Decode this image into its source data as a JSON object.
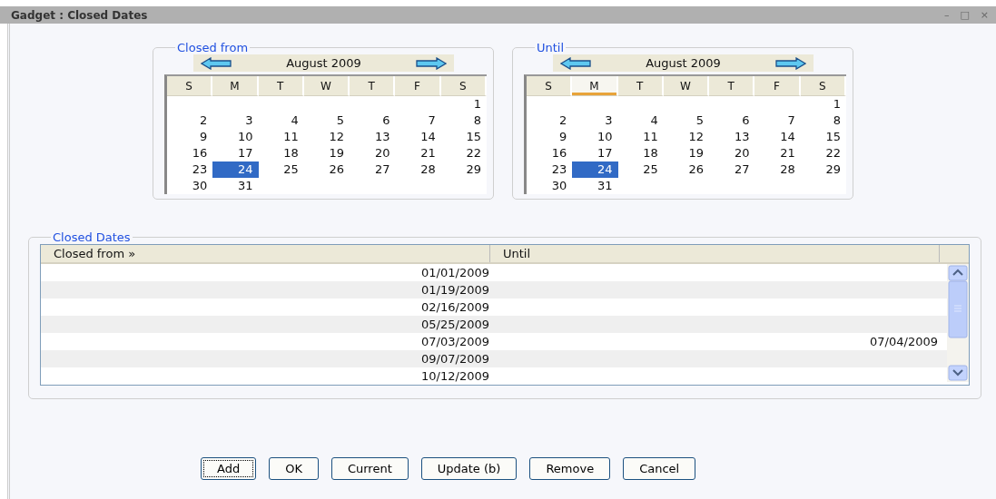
{
  "window": {
    "title": "Gadget : Closed Dates",
    "controls": [
      "–",
      "□",
      "×"
    ]
  },
  "calendars": [
    {
      "legend": "Closed from",
      "month": "August 2009",
      "weekdays": [
        {
          "label": "S",
          "highlighted": false
        },
        {
          "label": "M",
          "highlighted": false
        },
        {
          "label": "T",
          "highlighted": false
        },
        {
          "label": "W",
          "highlighted": false
        },
        {
          "label": "T",
          "highlighted": false
        },
        {
          "label": "F",
          "highlighted": false
        },
        {
          "label": "S",
          "highlighted": false
        }
      ],
      "weeks": [
        [
          {
            "day": "1",
            "selected": false
          }
        ],
        [
          {
            "day": "2",
            "selected": false
          },
          {
            "day": "3",
            "selected": false
          },
          {
            "day": "4",
            "selected": false
          },
          {
            "day": "5",
            "selected": false
          },
          {
            "day": "6",
            "selected": false
          },
          {
            "day": "7",
            "selected": false
          },
          {
            "day": "8",
            "selected": false
          }
        ],
        [
          {
            "day": "9",
            "selected": false
          },
          {
            "day": "10",
            "selected": false
          },
          {
            "day": "11",
            "selected": false
          },
          {
            "day": "12",
            "selected": false
          },
          {
            "day": "13",
            "selected": false
          },
          {
            "day": "14",
            "selected": false
          },
          {
            "day": "15",
            "selected": false
          }
        ],
        [
          {
            "day": "16",
            "selected": false
          },
          {
            "day": "17",
            "selected": false
          },
          {
            "day": "18",
            "selected": false
          },
          {
            "day": "19",
            "selected": false
          },
          {
            "day": "20",
            "selected": false
          },
          {
            "day": "21",
            "selected": false
          },
          {
            "day": "22",
            "selected": false
          }
        ],
        [
          {
            "day": "23",
            "selected": false
          },
          {
            "day": "24",
            "selected": true
          },
          {
            "day": "25",
            "selected": false
          },
          {
            "day": "26",
            "selected": false
          },
          {
            "day": "27",
            "selected": false
          },
          {
            "day": "28",
            "selected": false
          },
          {
            "day": "29",
            "selected": false
          }
        ],
        [
          {
            "day": "30",
            "selected": false
          },
          {
            "day": "31",
            "selected": false
          }
        ]
      ]
    },
    {
      "legend": "Until",
      "month": "August 2009",
      "weekdays": [
        {
          "label": "S",
          "highlighted": false
        },
        {
          "label": "M",
          "highlighted": true
        },
        {
          "label": "T",
          "highlighted": false
        },
        {
          "label": "W",
          "highlighted": false
        },
        {
          "label": "T",
          "highlighted": false
        },
        {
          "label": "F",
          "highlighted": false
        },
        {
          "label": "S",
          "highlighted": false
        }
      ],
      "weeks": [
        [
          {
            "day": "1",
            "selected": false
          }
        ],
        [
          {
            "day": "2",
            "selected": false
          },
          {
            "day": "3",
            "selected": false
          },
          {
            "day": "4",
            "selected": false
          },
          {
            "day": "5",
            "selected": false
          },
          {
            "day": "6",
            "selected": false
          },
          {
            "day": "7",
            "selected": false
          },
          {
            "day": "8",
            "selected": false
          }
        ],
        [
          {
            "day": "9",
            "selected": false
          },
          {
            "day": "10",
            "selected": false
          },
          {
            "day": "11",
            "selected": false
          },
          {
            "day": "12",
            "selected": false
          },
          {
            "day": "13",
            "selected": false
          },
          {
            "day": "14",
            "selected": false
          },
          {
            "day": "15",
            "selected": false
          }
        ],
        [
          {
            "day": "16",
            "selected": false
          },
          {
            "day": "17",
            "selected": false
          },
          {
            "day": "18",
            "selected": false
          },
          {
            "day": "19",
            "selected": false
          },
          {
            "day": "20",
            "selected": false
          },
          {
            "day": "21",
            "selected": false
          },
          {
            "day": "22",
            "selected": false
          }
        ],
        [
          {
            "day": "23",
            "selected": false
          },
          {
            "day": "24",
            "selected": true
          },
          {
            "day": "25",
            "selected": false
          },
          {
            "day": "26",
            "selected": false
          },
          {
            "day": "27",
            "selected": false
          },
          {
            "day": "28",
            "selected": false
          },
          {
            "day": "29",
            "selected": false
          }
        ],
        [
          {
            "day": "30",
            "selected": false
          },
          {
            "day": "31",
            "selected": false
          }
        ]
      ]
    }
  ],
  "closed_dates": {
    "legend": "Closed Dates",
    "columns": [
      "Closed from »",
      "Until"
    ],
    "rows": [
      {
        "closed_from": "01/01/2009"
      },
      {
        "closed_from": "01/19/2009"
      },
      {
        "closed_from": "02/16/2009"
      },
      {
        "closed_from": "05/25/2009"
      },
      {
        "closed_from": "07/03/2009",
        "until": "07/04/2009"
      },
      {
        "closed_from": "09/07/2009"
      },
      {
        "closed_from": "10/12/2009"
      }
    ]
  },
  "buttons": [
    {
      "label": "Add",
      "focused": true
    },
    {
      "label": "OK",
      "focused": false
    },
    {
      "label": "Current",
      "focused": false
    },
    {
      "label": "Update (b)",
      "focused": false
    },
    {
      "label": "Remove",
      "focused": false
    },
    {
      "label": "Cancel",
      "focused": false
    }
  ]
}
